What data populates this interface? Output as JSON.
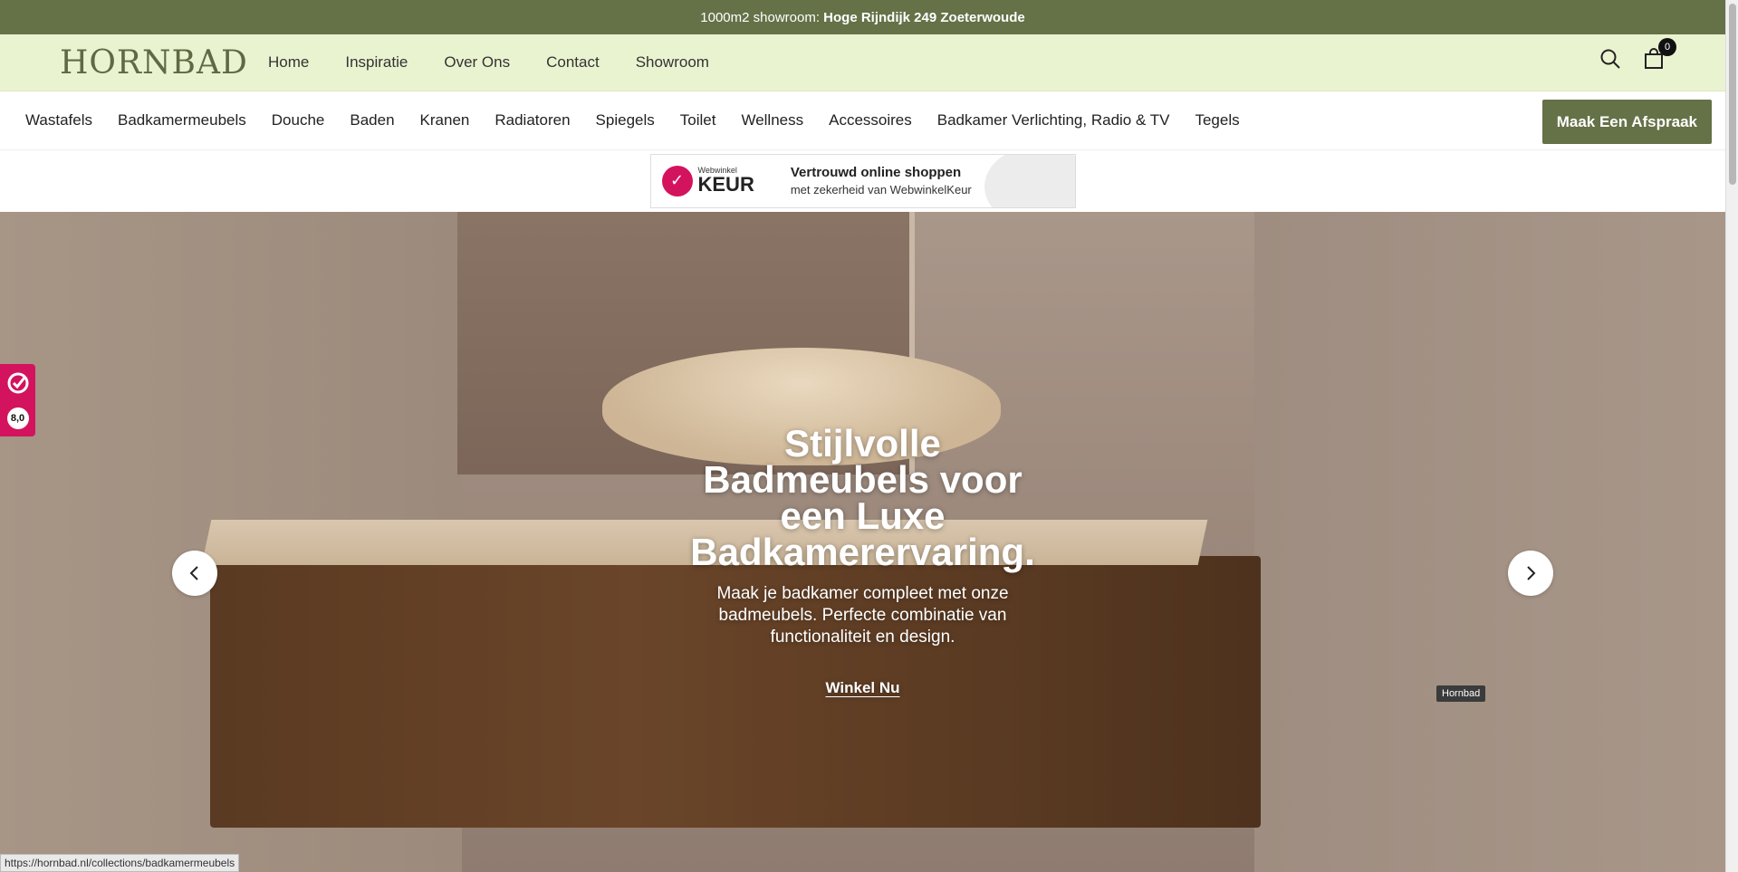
{
  "announcement": {
    "prefix": "1000m2 showroom:",
    "address": "Hoge Rijndijk 249 Zoeterwoude"
  },
  "header": {
    "logo": "HORNBAD",
    "nav": [
      "Home",
      "Inspiratie",
      "Over Ons",
      "Contact",
      "Showroom"
    ],
    "cart_count": "0"
  },
  "categories": {
    "items": [
      "Wastafels",
      "Badkamermeubels",
      "Douche",
      "Baden",
      "Kranen",
      "Radiatoren",
      "Spiegels",
      "Toilet",
      "Wellness",
      "Accessoires",
      "Badkamer Verlichting, Radio & TV",
      "Tegels"
    ],
    "cta_label": "Maak Een Afspraak"
  },
  "trust": {
    "logo_small": "Webwinkel",
    "logo_big": "KEUR",
    "title": "Vertrouwd online shoppen",
    "subtitle": "met zekerheid van WebwinkelKeur"
  },
  "hero": {
    "title": "Stijlvolle Badmeubels voor een Luxe Badkamerervaring.",
    "text": "Maak je badkamer compleet met onze badmeubels. Perfecte combinatie van functionaliteit en design.",
    "link": "Winkel Nu",
    "image_tag": "Hornbad"
  },
  "rating": {
    "score": "8,0"
  },
  "status": {
    "url": "https://hornbad.nl/collections/badkamermeubels"
  },
  "colors": {
    "brand_green": "#657147",
    "header_bg": "#eaf3d0",
    "webwinkel_pink": "#d3135e"
  }
}
